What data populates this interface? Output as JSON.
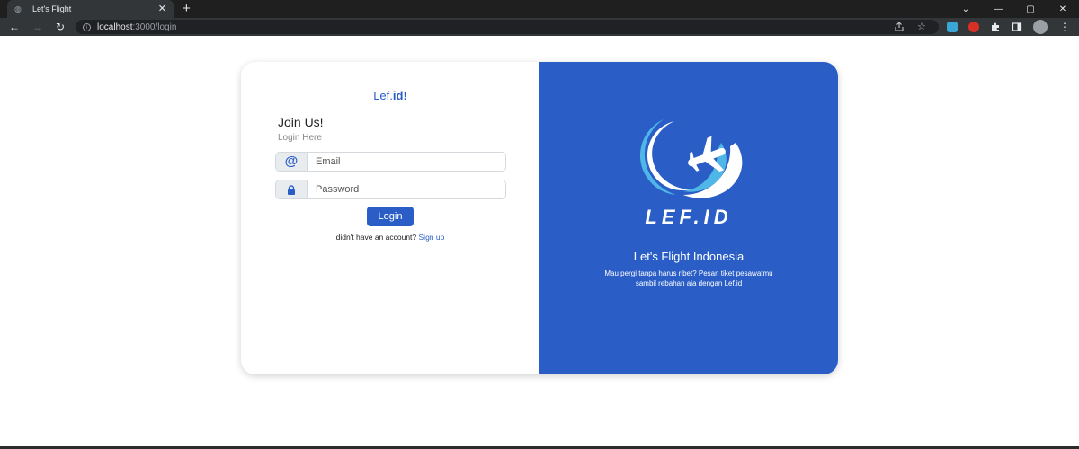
{
  "browser": {
    "tab_title": "Let's Flight",
    "tab_close": "✕",
    "new_tab": "+",
    "url_host": "localhost",
    "url_path": ":3000/login",
    "window_controls": {
      "minimize": "—",
      "maximize": "▢",
      "close": "✕",
      "tab_search": "⌄"
    },
    "icons": {
      "back": "back-arrow-icon",
      "forward": "forward-arrow-icon",
      "reload": "reload-icon",
      "info": "info-icon",
      "share": "share-icon",
      "bookmark": "star-icon",
      "extensions": "puzzle-icon",
      "side_panel": "side-panel-icon",
      "menu": "kebab-menu-icon"
    }
  },
  "login": {
    "brand_prefix": "Lef.",
    "brand_suffix": "id!",
    "title": "Join Us!",
    "subtitle": "Login Here",
    "email_placeholder": "Email",
    "password_placeholder": "Password",
    "email_addon": "@",
    "login_button": "Login",
    "signup_prompt": "didn't have an account? ",
    "signup_link": "Sign up"
  },
  "promo": {
    "wordmark": "LEF.ID",
    "tagline": "Let's Flight Indonesia",
    "description_line1": "Mau pergi tanpa harus ribet? Pesan tiket pesawatmu",
    "description_line2": "sambil rebahan aja dengan Lef.id"
  },
  "colors": {
    "accent": "#2a5ec6",
    "logo_swoosh_light": "#4fb6e8",
    "logo_swoosh_white": "#ffffff"
  }
}
